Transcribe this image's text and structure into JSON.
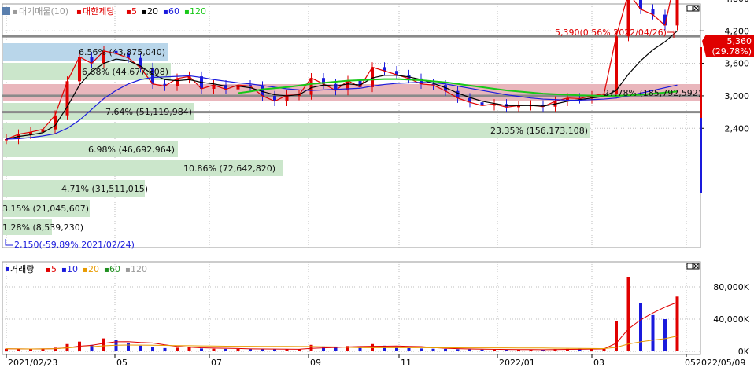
{
  "price_panel": {
    "legend_muted": "대기매물(10)",
    "legend_title": "대한제당",
    "ma_labels": [
      "5",
      "20",
      "60",
      "120"
    ],
    "ma_colors": [
      "#e00000",
      "#000000",
      "#1a1adc",
      "#18c818"
    ],
    "muted_color": "#9a9a9a",
    "y_ticks": [
      "4,800",
      "4,200",
      "3,600",
      "3,000",
      "2,400"
    ],
    "current_price": "5,360",
    "current_change": "(29.78%)",
    "high_note": "5,390(0.56% 2022/04/26)",
    "low_note": "2,150(-59.89% 2021/02/24)",
    "volume_profile": [
      {
        "text": "6.56% (43,875,040)",
        "color": "#b9d6ea"
      },
      {
        "text": "6.68% (44,677,808)",
        "color": "#cbe6cb"
      },
      {
        "text": "27.78% (185,792,592)",
        "color": "#e9b6bc"
      },
      {
        "text": "7.64% (51,119,984)",
        "color": "#cbe6cb"
      },
      {
        "text": "23.35% (156,173,108)",
        "color": "#cbe6cb"
      },
      {
        "text": "6.98% (46,692,964)",
        "color": "#cbe6cb"
      },
      {
        "text": "10.86% (72,642,820)",
        "color": "#cbe6cb"
      },
      {
        "text": "4.71% (31,511,015)",
        "color": "#cbe6cb"
      },
      {
        "text": "3.15% (21,045,607)",
        "color": "#cbe6cb"
      },
      {
        "text": "1.28% (8,539,230)",
        "color": "#cbe6cb"
      }
    ]
  },
  "volume_panel": {
    "legend_title": "거래량",
    "ma_labels": [
      "5",
      "10",
      "20",
      "60",
      "120"
    ],
    "ma_colors": [
      "#e00000",
      "#1a1adc",
      "#e89a00",
      "#1f8f1f",
      "#9a9a9a"
    ],
    "y_ticks": [
      "80,000K",
      "40,000K",
      "0K"
    ]
  },
  "x_axis": {
    "labels": [
      "2021/02/23",
      "05",
      "07",
      "09",
      "11",
      "2022/01",
      "03",
      "05"
    ],
    "end_label": "2022/05/09"
  },
  "chart_data": [
    {
      "type": "candlestick",
      "title": "대한제당",
      "x_range": [
        "2021/02/23",
        "2022/05/09"
      ],
      "ylim": [
        1950,
        5650
      ],
      "y_ticks": [
        4800,
        4200,
        3600,
        3000,
        2400
      ],
      "horizontal_lines": [
        3000,
        2700,
        4100
      ],
      "highlight_band": [
        4400,
        4600
      ],
      "high": {
        "value": 5390,
        "date": "2022/04/26"
      },
      "low": {
        "value": 2150,
        "date": "2021/02/24"
      },
      "close": 5360,
      "change_pct": 29.78,
      "series": [
        {
          "name": "5",
          "values": [
            2200,
            2290,
            2330,
            2380,
            2640,
            3270,
            3720,
            3600,
            3830,
            3780,
            3700,
            3520,
            3220,
            3180,
            3320,
            3360,
            3130,
            3200,
            3120,
            3200,
            3180,
            3000,
            2900,
            3010,
            3020,
            3330,
            3220,
            3100,
            3280,
            3160,
            3530,
            3460,
            3390,
            3320,
            3220,
            3200,
            3090,
            2960,
            2880,
            2820,
            2850,
            2790,
            2820,
            2830,
            2800,
            2900,
            2960,
            2950,
            3000,
            3040,
            4100,
            4900,
            4600,
            4500,
            4300,
            5360
          ]
        },
        {
          "name": "20",
          "values": [
            2200,
            2250,
            2280,
            2320,
            2450,
            2800,
            3200,
            3450,
            3600,
            3680,
            3650,
            3550,
            3400,
            3300,
            3280,
            3300,
            3250,
            3220,
            3180,
            3180,
            3150,
            3080,
            3020,
            3000,
            3020,
            3150,
            3200,
            3180,
            3220,
            3200,
            3330,
            3380,
            3380,
            3350,
            3300,
            3230,
            3150,
            3050,
            2970,
            2900,
            2860,
            2820,
            2820,
            2820,
            2810,
            2850,
            2900,
            2930,
            2960,
            2990,
            3100,
            3400,
            3650,
            3850,
            4000,
            4200
          ]
        },
        {
          "name": "60",
          "values": [
            2200,
            2210,
            2230,
            2260,
            2300,
            2400,
            2550,
            2750,
            2950,
            3100,
            3220,
            3300,
            3340,
            3350,
            3360,
            3370,
            3340,
            3300,
            3270,
            3240,
            3220,
            3190,
            3160,
            3130,
            3110,
            3100,
            3110,
            3120,
            3130,
            3140,
            3180,
            3210,
            3230,
            3240,
            3250,
            3240,
            3220,
            3180,
            3140,
            3100,
            3060,
            3020,
            2990,
            2960,
            2940,
            2930,
            2920,
            2920,
            2930,
            2940,
            2960,
            3000,
            3050,
            3100,
            3150,
            3200
          ]
        },
        {
          "name": "120",
          "values": [
            null,
            null,
            null,
            null,
            null,
            null,
            null,
            null,
            null,
            null,
            null,
            null,
            null,
            null,
            null,
            null,
            null,
            null,
            null,
            3050,
            3080,
            3120,
            3140,
            3160,
            3190,
            3220,
            3240,
            3260,
            3280,
            3290,
            3300,
            3310,
            3310,
            3300,
            3290,
            3270,
            3250,
            3220,
            3190,
            3160,
            3130,
            3100,
            3080,
            3060,
            3040,
            3030,
            3020,
            3010,
            3005,
            3000,
            3000,
            3010,
            3020,
            3040,
            3060,
            3080
          ]
        }
      ]
    },
    {
      "type": "bar",
      "title": "거래량",
      "ylim": [
        0,
        100000
      ],
      "y_ticks": [
        80000,
        40000,
        0
      ],
      "unit": "K",
      "values": [
        3200,
        2900,
        2500,
        3500,
        4500,
        9000,
        12000,
        8000,
        16000,
        14000,
        10000,
        7000,
        5000,
        4000,
        4500,
        5000,
        3500,
        3200,
        3000,
        3000,
        2800,
        2600,
        2400,
        2500,
        2600,
        8000,
        6000,
        4500,
        6500,
        5000,
        9000,
        7000,
        5500,
        4000,
        3500,
        3200,
        3000,
        2600,
        2400,
        2200,
        2300,
        2100,
        2000,
        2100,
        2100,
        2800,
        3000,
        3100,
        3000,
        3300,
        38000,
        92000,
        60000,
        45000,
        40000,
        68000
      ]
    }
  ]
}
